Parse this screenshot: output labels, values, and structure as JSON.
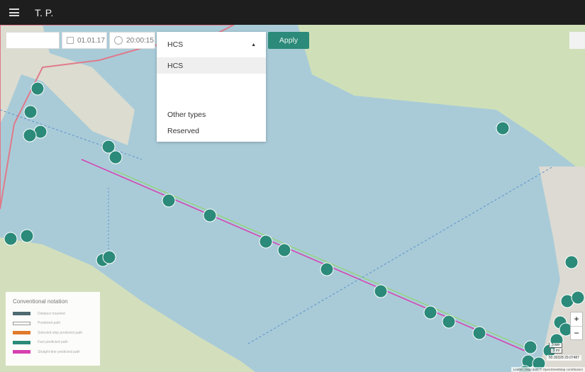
{
  "header": {
    "title": "T. P."
  },
  "filters": {
    "search_value": "",
    "date": "01.01.17",
    "time": "20:00:15"
  },
  "type_select": {
    "selected": "HCS",
    "options": [
      "HCS",
      "Other types",
      "Reserved"
    ],
    "apply_label": "Apply"
  },
  "legend": {
    "title": "Conventional notation",
    "items": [
      {
        "label": "Distance traveled",
        "color": "#4f6b72"
      },
      {
        "label": "Predicted path",
        "color": "#ffffff"
      },
      {
        "label": "Selected ship predicted path",
        "color": "#e07a2c"
      },
      {
        "label": "Fact predicted path",
        "color": "#2b8a79"
      },
      {
        "label": "Straight-line predicted path",
        "color": "#d63fb0"
      }
    ]
  },
  "map": {
    "scale_km": "5 km",
    "scale_mi": "3 mi",
    "coords": "60.00328  29.07487",
    "attribution": "Leaflet | Map data © OpenStreetMap contributors",
    "zoom_in": "+",
    "zoom_out": "−"
  },
  "colors": {
    "accent": "#2b8a79",
    "water": "#a9cbd8"
  }
}
